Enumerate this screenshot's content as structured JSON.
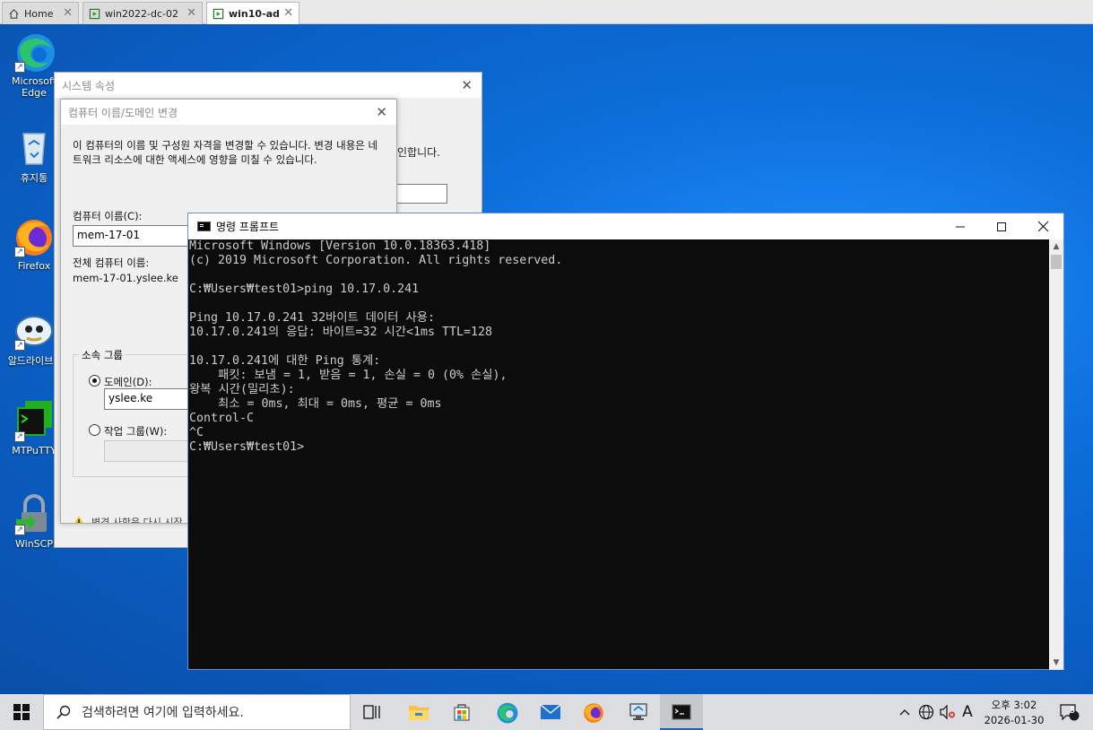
{
  "vm_tabs": [
    {
      "label": "Home"
    },
    {
      "label": "win2022-dc-02"
    },
    {
      "label": "win10-ad"
    }
  ],
  "desktop_icons": [
    {
      "label": "Microsoft Edge",
      "icon": "edge-icon"
    },
    {
      "label": "휴지통",
      "icon": "recycle-bin-icon"
    },
    {
      "label": "Firefox",
      "icon": "firefox-icon"
    },
    {
      "label": "알드라이브",
      "icon": "aldrive-icon"
    },
    {
      "label": "MTPuTTY",
      "icon": "mtputty-icon"
    },
    {
      "label": "WinSCP",
      "icon": "winscp-icon"
    }
  ],
  "system_properties": {
    "title": "시스템 속성",
    "partial_text": "인합니다."
  },
  "computer_name_dialog": {
    "title": "컴퓨터 이름/도메인 변경",
    "description": "이 컴퓨터의 이름 및 구성원 자격을 변경할 수 있습니다. 변경 내용은 네트워크 리소스에 대한 액세스에 영향을 미칠 수 있습니다.",
    "computer_name_label": "컴퓨터 이름(C):",
    "computer_name_value": "mem-17-01",
    "full_name_label": "전체 컴퓨터 이름:",
    "full_name_value": "mem-17-01.yslee.ke",
    "member_of_label": "소속 그룹",
    "domain_label": "도메인(D):",
    "domain_value": "yslee.ke",
    "domain_selected": true,
    "workgroup_label": "작업 그룹(W):",
    "workgroup_value": "",
    "warning_partial": "변경 사항은 다시 시작"
  },
  "console": {
    "title": "명령 프롬프트",
    "lines": [
      "Microsoft Windows [Version 10.0.18363.418]",
      "(c) 2019 Microsoft Corporation. All rights reserved.",
      "",
      "C:₩Users₩test01>ping 10.17.0.241",
      "",
      "Ping 10.17.0.241 32바이트 데이터 사용:",
      "10.17.0.241의 응답: 바이트=32 시간<1ms TTL=128",
      "",
      "10.17.0.241에 대한 Ping 통계:",
      "    패킷: 보냄 = 1, 받음 = 1, 손실 = 0 (0% 손실),",
      "왕복 시간(밀리초):",
      "    최소 = 0ms, 최대 = 0ms, 평균 = 0ms",
      "Control-C",
      "^C",
      "C:₩Users₩test01>"
    ]
  },
  "taskbar": {
    "search_placeholder": "검색하려면 여기에 입력하세요.",
    "apps": [
      "task-view-icon",
      "file-explorer-icon",
      "store-icon",
      "edge-icon",
      "mail-icon",
      "firefox-icon",
      "remote-desktop-icon",
      "command-prompt-icon"
    ],
    "ime_label": "A",
    "clock_time": "오후 3:02",
    "clock_date": "2026-01-30",
    "notification_count": "5"
  },
  "colors": {
    "desktop": "#0c6ed8",
    "console_bg": "#0c0c0c",
    "console_text": "#cccccc",
    "accent": "#0a66c8"
  }
}
